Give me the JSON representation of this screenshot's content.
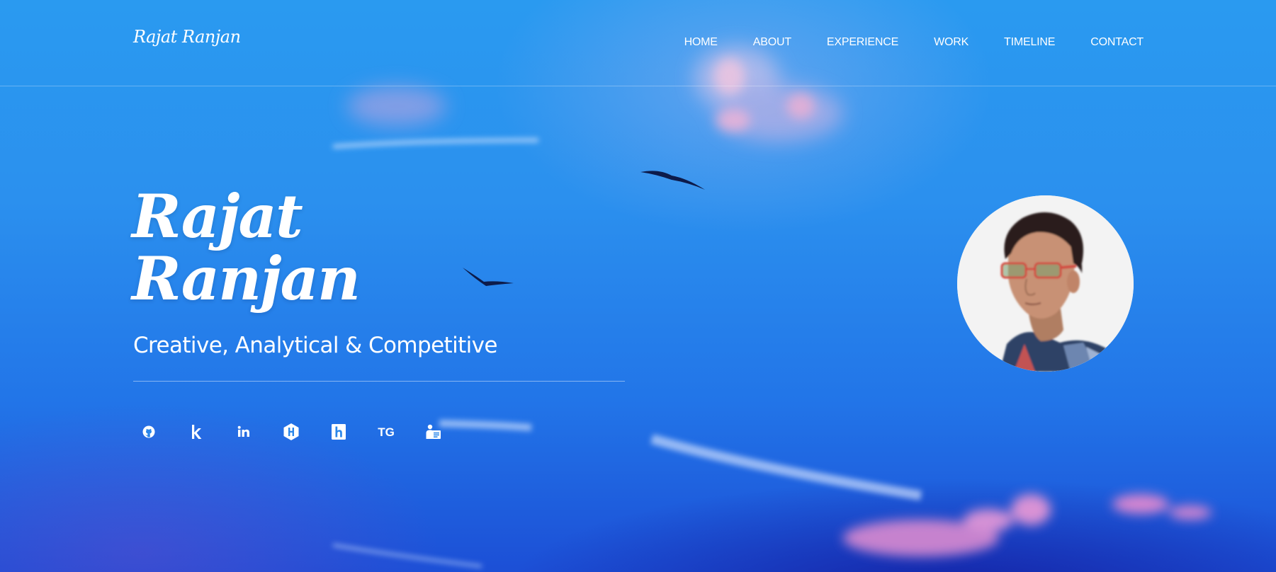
{
  "header": {
    "brand": "Rajat Ranjan",
    "nav": [
      "HOME",
      "ABOUT",
      "EXPERIENCE",
      "WORK",
      "TIMELINE",
      "CONTACT"
    ]
  },
  "hero": {
    "name_first": "Rajat",
    "name_last": "Ranjan",
    "tagline": "Creative, Analytical & Competitive"
  },
  "socials": [
    {
      "icon": "github-icon"
    },
    {
      "icon": "kaggle-icon"
    },
    {
      "icon": "linkedin-icon"
    },
    {
      "icon": "hackerearth-icon"
    },
    {
      "icon": "hackerrank-icon"
    },
    {
      "icon": "tg-icon",
      "label": "TG"
    },
    {
      "icon": "resume-icon"
    }
  ],
  "colors": {
    "sky_top": "#2a9af0",
    "sky_bottom": "#1c4fd6",
    "text": "#ffffff"
  }
}
